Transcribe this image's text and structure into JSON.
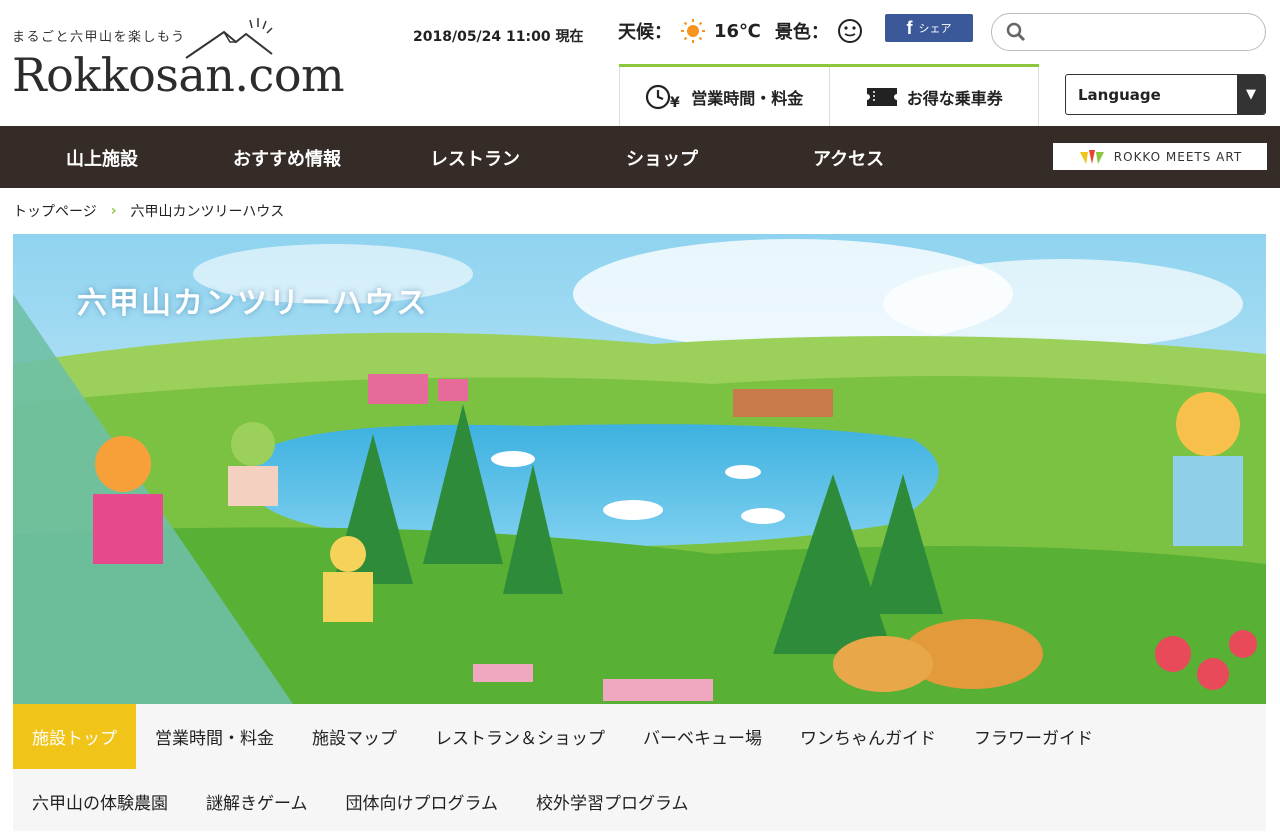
{
  "logo": {
    "tagline": "まるごと六甲山を楽しもう",
    "brand": "Rokkosan.com"
  },
  "status": {
    "datetime": "2018/05/24 11:00 現在",
    "weather_label": "天候：",
    "temperature": "16℃",
    "scenery_label": "景色："
  },
  "facebook": {
    "label": "シェア"
  },
  "search": {
    "placeholder": ""
  },
  "header_tabs": [
    {
      "label": "営業時間・料金"
    },
    {
      "label": "お得な乗車券"
    }
  ],
  "language": {
    "label": "Language"
  },
  "nav": [
    {
      "label": "山上施設"
    },
    {
      "label": "おすすめ情報"
    },
    {
      "label": "レストラン"
    },
    {
      "label": "ショップ"
    },
    {
      "label": "アクセス"
    }
  ],
  "banner": {
    "label": "ROKKO MEETS ART"
  },
  "breadcrumb": [
    {
      "label": "トップページ"
    },
    {
      "label": "六甲山カンツリーハウス"
    }
  ],
  "hero": {
    "title": "六甲山カンツリーハウス"
  },
  "subnav_row1": [
    {
      "label": "施設トップ"
    },
    {
      "label": "営業時間・料金"
    },
    {
      "label": "施設マップ"
    },
    {
      "label": "レストラン＆ショップ"
    },
    {
      "label": "バーベキュー場"
    },
    {
      "label": "ワンちゃんガイド"
    },
    {
      "label": "フラワーガイド"
    }
  ],
  "subnav_row2": [
    {
      "label": "六甲山の体験農園"
    },
    {
      "label": "謎解きゲーム"
    },
    {
      "label": "団体向けプログラム"
    },
    {
      "label": "校外学習プログラム"
    }
  ],
  "colors": {
    "nav_bg": "#352b27",
    "accent_green": "#8cc63f",
    "active_yellow": "#f0c419",
    "facebook": "#3b5998"
  }
}
